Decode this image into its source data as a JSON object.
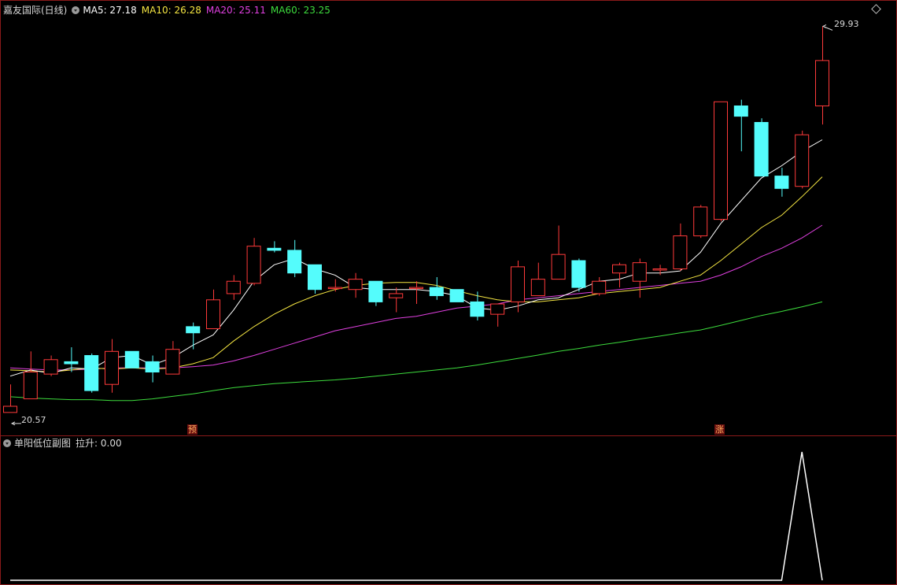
{
  "main_panel": {
    "stock_name": "嘉友国际(日线)",
    "indicators": [
      {
        "label": "MA5: 27.18",
        "color": "#ffffff"
      },
      {
        "label": "MA10: 26.28",
        "color": "#f5e642"
      },
      {
        "label": "MA20: 25.11",
        "color": "#e040e0"
      },
      {
        "label": "MA60: 23.25",
        "color": "#3ddc3d"
      }
    ],
    "high_label": "29.93",
    "low_label": "20.57",
    "signal_badges": {
      "pre": "预",
      "rise": "涨"
    }
  },
  "sub_panel": {
    "title": "单阳低位副图",
    "indicator_label": "拉升: 0.00"
  },
  "colors": {
    "up": "#ff3a3a",
    "down": "#54fcfc",
    "ma5": "#ffffff",
    "ma10": "#f5e642",
    "ma20": "#e040e0",
    "ma60": "#3ddc3d",
    "frame": "#8b1a1a",
    "signal_line": "#ffffff"
  },
  "chart_data": [
    {
      "type": "candlestick",
      "y_range": [
        20.3,
        30.3
      ],
      "candles": [
        {
          "o": 20.57,
          "c": 20.72,
          "h": 21.25,
          "l": 20.57
        },
        {
          "o": 20.9,
          "c": 21.55,
          "h": 22.05,
          "l": 20.9
        },
        {
          "o": 21.5,
          "c": 21.85,
          "h": 21.95,
          "l": 21.45
        },
        {
          "o": 21.8,
          "c": 21.75,
          "h": 22.15,
          "l": 21.55
        },
        {
          "o": 21.95,
          "c": 21.1,
          "h": 22.0,
          "l": 21.05
        },
        {
          "o": 21.25,
          "c": 22.05,
          "h": 22.35,
          "l": 21.05
        },
        {
          "o": 22.05,
          "c": 21.65,
          "h": 22.05,
          "l": 21.65
        },
        {
          "o": 21.8,
          "c": 21.55,
          "h": 21.95,
          "l": 21.3
        },
        {
          "o": 21.5,
          "c": 22.1,
          "h": 22.3,
          "l": 21.5
        },
        {
          "o": 22.65,
          "c": 22.5,
          "h": 22.75,
          "l": 22.1
        },
        {
          "o": 22.6,
          "c": 23.3,
          "h": 23.55,
          "l": 22.6
        },
        {
          "o": 23.45,
          "c": 23.75,
          "h": 23.9,
          "l": 23.3
        },
        {
          "o": 23.7,
          "c": 24.6,
          "h": 24.8,
          "l": 23.65
        },
        {
          "o": 24.55,
          "c": 24.5,
          "h": 24.72,
          "l": 24.45
        },
        {
          "o": 24.5,
          "c": 23.95,
          "h": 24.75,
          "l": 23.85
        },
        {
          "o": 24.15,
          "c": 23.55,
          "h": 24.15,
          "l": 23.45
        },
        {
          "o": 23.6,
          "c": 23.6,
          "h": 23.8,
          "l": 23.5
        },
        {
          "o": 23.55,
          "c": 23.8,
          "h": 23.95,
          "l": 23.35
        },
        {
          "o": 23.75,
          "c": 23.25,
          "h": 23.75,
          "l": 23.15
        },
        {
          "o": 23.35,
          "c": 23.45,
          "h": 23.6,
          "l": 23.0
        },
        {
          "o": 23.6,
          "c": 23.6,
          "h": 23.75,
          "l": 23.2
        },
        {
          "o": 23.6,
          "c": 23.4,
          "h": 23.85,
          "l": 23.3
        },
        {
          "o": 23.55,
          "c": 23.25,
          "h": 23.55,
          "l": 23.25
        },
        {
          "o": 23.25,
          "c": 22.9,
          "h": 23.5,
          "l": 22.8
        },
        {
          "o": 22.95,
          "c": 23.2,
          "h": 23.2,
          "l": 22.65
        },
        {
          "o": 23.25,
          "c": 24.1,
          "h": 24.25,
          "l": 23.0
        },
        {
          "o": 23.4,
          "c": 23.8,
          "h": 24.2,
          "l": 23.4
        },
        {
          "o": 23.8,
          "c": 24.4,
          "h": 25.1,
          "l": 23.8
        },
        {
          "o": 24.25,
          "c": 23.6,
          "h": 24.3,
          "l": 23.5
        },
        {
          "o": 23.45,
          "c": 23.75,
          "h": 23.85,
          "l": 23.4
        },
        {
          "o": 23.95,
          "c": 24.15,
          "h": 24.2,
          "l": 23.6
        },
        {
          "o": 23.75,
          "c": 24.2,
          "h": 24.3,
          "l": 23.35
        },
        {
          "o": 24.05,
          "c": 24.05,
          "h": 24.15,
          "l": 23.9
        },
        {
          "o": 24.05,
          "c": 24.85,
          "h": 25.15,
          "l": 24.0
        },
        {
          "o": 24.85,
          "c": 25.55,
          "h": 25.6,
          "l": 24.8
        },
        {
          "o": 25.25,
          "c": 28.1,
          "h": 28.1,
          "l": 25.2
        },
        {
          "o": 28.0,
          "c": 27.75,
          "h": 28.15,
          "l": 26.9
        },
        {
          "o": 27.6,
          "c": 26.3,
          "h": 27.7,
          "l": 26.3
        },
        {
          "o": 26.3,
          "c": 26.0,
          "h": 26.5,
          "l": 25.8
        },
        {
          "o": 26.05,
          "c": 27.3,
          "h": 27.4,
          "l": 26.0
        },
        {
          "o": 28.0,
          "c": 29.1,
          "h": 29.93,
          "l": 27.55
        }
      ],
      "ma5": [
        21.45,
        21.6,
        21.52,
        21.65,
        21.62,
        21.9,
        21.95,
        21.72,
        21.9,
        22.2,
        22.45,
        23.05,
        23.75,
        24.15,
        24.3,
        24.05,
        23.9,
        23.6,
        23.55,
        23.55,
        23.55,
        23.5,
        23.4,
        23.1,
        23.05,
        23.15,
        23.3,
        23.35,
        23.55,
        23.75,
        23.8,
        23.95,
        23.95,
        24.0,
        24.45,
        25.15,
        25.7,
        26.25,
        26.55,
        26.9,
        27.18
      ],
      "ma10": [
        21.6,
        21.58,
        21.55,
        21.6,
        21.65,
        21.62,
        21.65,
        21.62,
        21.65,
        21.75,
        21.9,
        22.3,
        22.65,
        22.95,
        23.2,
        23.4,
        23.55,
        23.65,
        23.7,
        23.72,
        23.72,
        23.65,
        23.52,
        23.4,
        23.3,
        23.25,
        23.25,
        23.3,
        23.35,
        23.45,
        23.5,
        23.55,
        23.6,
        23.75,
        23.9,
        24.25,
        24.65,
        25.05,
        25.35,
        25.8,
        26.28
      ],
      "ma20": [
        21.65,
        21.62,
        21.6,
        21.6,
        21.62,
        21.65,
        21.65,
        21.65,
        21.65,
        21.68,
        21.72,
        21.82,
        21.95,
        22.1,
        22.25,
        22.4,
        22.55,
        22.65,
        22.75,
        22.85,
        22.9,
        23.0,
        23.1,
        23.15,
        23.2,
        23.3,
        23.35,
        23.4,
        23.45,
        23.5,
        23.55,
        23.6,
        23.65,
        23.7,
        23.75,
        23.9,
        24.1,
        24.35,
        24.55,
        24.8,
        25.11
      ],
      "ma60": [
        20.95,
        20.92,
        20.9,
        20.88,
        20.88,
        20.86,
        20.86,
        20.9,
        20.96,
        21.02,
        21.1,
        21.17,
        21.22,
        21.27,
        21.3,
        21.33,
        21.36,
        21.4,
        21.45,
        21.5,
        21.55,
        21.6,
        21.65,
        21.72,
        21.8,
        21.88,
        21.96,
        22.05,
        22.12,
        22.2,
        22.27,
        22.35,
        22.42,
        22.5,
        22.57,
        22.68,
        22.8,
        22.92,
        23.02,
        23.13,
        23.25
      ]
    },
    {
      "type": "line",
      "name": "拉升",
      "y_range": [
        0,
        1
      ],
      "values": [
        0,
        0,
        0,
        0,
        0,
        0,
        0,
        0,
        0,
        0,
        0,
        0,
        0,
        0,
        0,
        0,
        0,
        0,
        0,
        0,
        0,
        0,
        0,
        0,
        0,
        0,
        0,
        0,
        0,
        0,
        0,
        0,
        0,
        0,
        0,
        0,
        0,
        0,
        0,
        1,
        0
      ]
    }
  ]
}
